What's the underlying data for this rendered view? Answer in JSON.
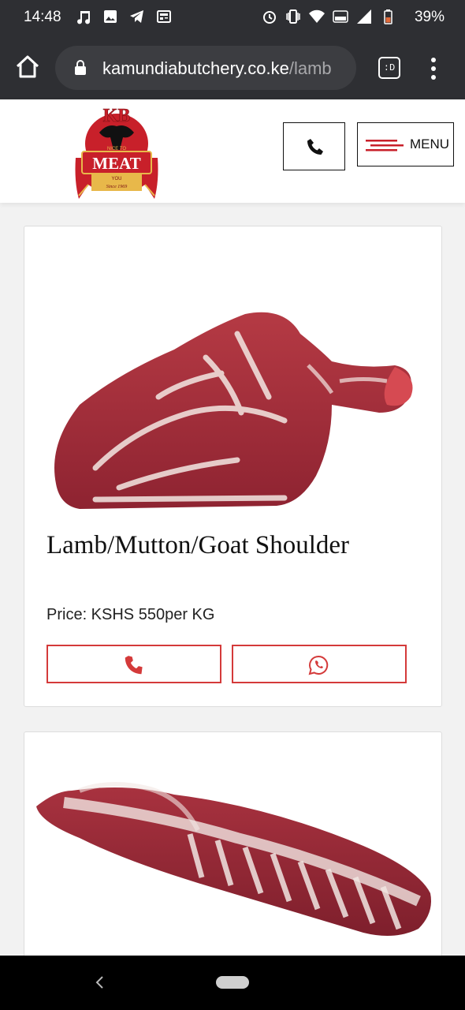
{
  "status_bar": {
    "time": "14:48",
    "battery": "39%",
    "icons": [
      "music-note-icon",
      "image-icon",
      "telegram-icon",
      "news-icon",
      "alarm-icon",
      "vibrate-icon",
      "wifi-icon",
      "volte-icon",
      "signal-icon",
      "battery-icon"
    ]
  },
  "browser": {
    "url_host": "kamundiabutchery.co.ke",
    "url_path": "/lamb",
    "tab_label": ":D"
  },
  "header": {
    "logo": {
      "top_text": "KB",
      "main_text": "MEAT",
      "small_text": "NICE TO",
      "bottom_text": "YOU",
      "since_text": "Since 1969",
      "brand_color": "#c8202a",
      "accent_color": "#e8b84a"
    },
    "menu_label": "MENU",
    "accent_color": "#c8202a"
  },
  "products": [
    {
      "title": "Lamb/Mutton/Goat Shoulder",
      "price": "Price: KSHS 550per KG"
    }
  ],
  "colors": {
    "button_border": "#d43a3a",
    "icon_red": "#d43a3a",
    "dark_bar": "#2e2f33"
  }
}
